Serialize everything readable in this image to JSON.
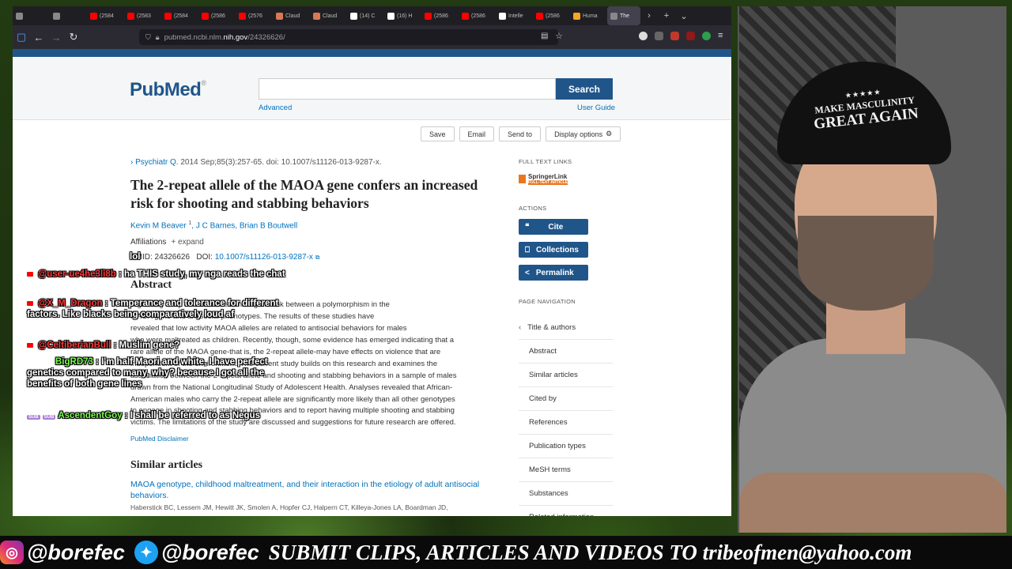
{
  "browser": {
    "tabs": [
      {
        "label": "",
        "color": "#888888"
      },
      {
        "label": "",
        "color": "#888888"
      },
      {
        "label": "(2584",
        "color": "#ff0000"
      },
      {
        "label": "(2583",
        "color": "#ff0000"
      },
      {
        "label": "(2584",
        "color": "#ff0000"
      },
      {
        "label": "(2586",
        "color": "#ff0000"
      },
      {
        "label": "(2576",
        "color": "#ff0000"
      },
      {
        "label": "Claud",
        "color": "#d97757"
      },
      {
        "label": "Claud",
        "color": "#d97757"
      },
      {
        "label": "(14) C",
        "color": "#ffffff"
      },
      {
        "label": "(16) H",
        "color": "#ffffff"
      },
      {
        "label": "(2586",
        "color": "#ff0000"
      },
      {
        "label": "(2586",
        "color": "#ff0000"
      },
      {
        "label": "Intelle",
        "color": "#ffffff"
      },
      {
        "label": "(2586",
        "color": "#ff0000"
      },
      {
        "label": "Huma",
        "color": "#f5a623"
      },
      {
        "label": "The",
        "color": "#888888",
        "active": true
      }
    ],
    "url_host": "pubmed.ncbi.nlm.",
    "url_domain": "nih.gov",
    "url_path": "/24326626/"
  },
  "pubmed": {
    "logo_text": "PubMed",
    "logo_reg": "®",
    "search_placeholder": "",
    "search_button": "Search",
    "advanced": "Advanced",
    "user_guide": "User Guide",
    "actions_bar": [
      "Save",
      "Email",
      "Send to",
      "Display options"
    ],
    "journal_name": "Psychiatr Q.",
    "journal_cite": " 2014 Sep;85(3):257-65. doi: 10.1007/s11126-013-9287-x.",
    "title": "The 2-repeat allele of the MAOA gene confers an increased risk for shooting and stabbing behaviors",
    "author1": "Kevin M Beaver",
    "author1_sup": "1",
    "author_rest": ", J C Barnes, Brian B Boutwell",
    "affiliations": "Affiliations",
    "expand": "+ expand",
    "pmid_label": "PMID: 24326626",
    "doi_label": "DOI: ",
    "doi_link": "10.1007/s11126-013-9287-x",
    "abstract_heading": "Abstract",
    "abstract_lines": [
      "A growing body of research examining the link between a polymorphism in the",
      "MAOA gene and antisocial phenotypes. The results of these studies have",
      "revealed that low activity MAOA alleles are related to antisocial behaviors for males",
      "who were maltreated as children. Recently, though, some evidence has emerged indicating that a",
      "rare allele of the MAOA gene-that is, the 2-repeat allele-may have effects on violence that are",
      "independent of the environment. The current study builds on this research and examines the",
      "association between the 2-repeat allele and shooting and stabbing behaviors in a sample of males",
      "drawn from the National Longitudinal Study of Adolescent Health. Analyses revealed that African-",
      "American males who carry the 2-repeat allele are significantly more likely than all other genotypes",
      "to engage in shooting and stabbing behaviors and to report having multiple shooting and stabbing",
      "victims. The limitations of the study are discussed and suggestions for future research are offered."
    ],
    "disclaimer": "PubMed Disclaimer",
    "similar_heading": "Similar articles",
    "similar_title": "MAOA genotype, childhood maltreatment, and their interaction in the etiology of adult antisocial behaviors.",
    "similar_authors": "Haberstick BC, Lessem JM, Hewitt JK, Smolen A, Hopfer CJ, Halpern CT, Killeya-Jones LA, Boardman JD,",
    "full_text_links": "FULL TEXT LINKS",
    "springer": "SpringerLink",
    "springer_sub": "FULL-TEXT ARTICLE",
    "actions_heading": "ACTIONS",
    "cite": "Cite",
    "collections": "Collections",
    "permalink": "Permalink",
    "page_nav_heading": "PAGE NAVIGATION",
    "page_nav": [
      "Title & authors",
      "Abstract",
      "Similar articles",
      "Cited by",
      "References",
      "Publication types",
      "MeSH terms",
      "Substances",
      "Related information"
    ]
  },
  "chat": [
    {
      "user": "",
      "text": "lol"
    },
    {
      "user": "@user-ue4he3li8b",
      "text": "ha THIS study, my nga reads the chat"
    },
    {
      "user": "@X_M_Dragon",
      "text": "Temperance and tolerance for different factors. Like blacks being comparatively loud af"
    },
    {
      "user": "@CeltiberianBull",
      "text": "Muslim gene?"
    },
    {
      "user": "BigRD73",
      "text": "I'm half Maori and white, I have perfect genetics compared to many, why? because I got all the benefits of both gene lines"
    },
    {
      "user": "AscendentGoy",
      "text": "I shall be referred to as Negus",
      "badges": [
        "SUB",
        "SUB"
      ]
    }
  ],
  "webcam": {
    "cap_stars": "★★★★★",
    "cap_line1": "MAKE MASCULINITY",
    "cap_line2": "GREAT AGAIN"
  },
  "banner": {
    "instagram": "@borefec",
    "twitter": "@borefec",
    "submit": "SUBMIT CLIPS, ARTICLES AND VIDEOS TO tribeofmen@yahoo.com"
  },
  "colors": {
    "pubmed_blue": "#20558a",
    "link_blue": "#0071bc",
    "chat_user_red": "#ff3b3b",
    "chat_user_green": "#7bff4f"
  }
}
